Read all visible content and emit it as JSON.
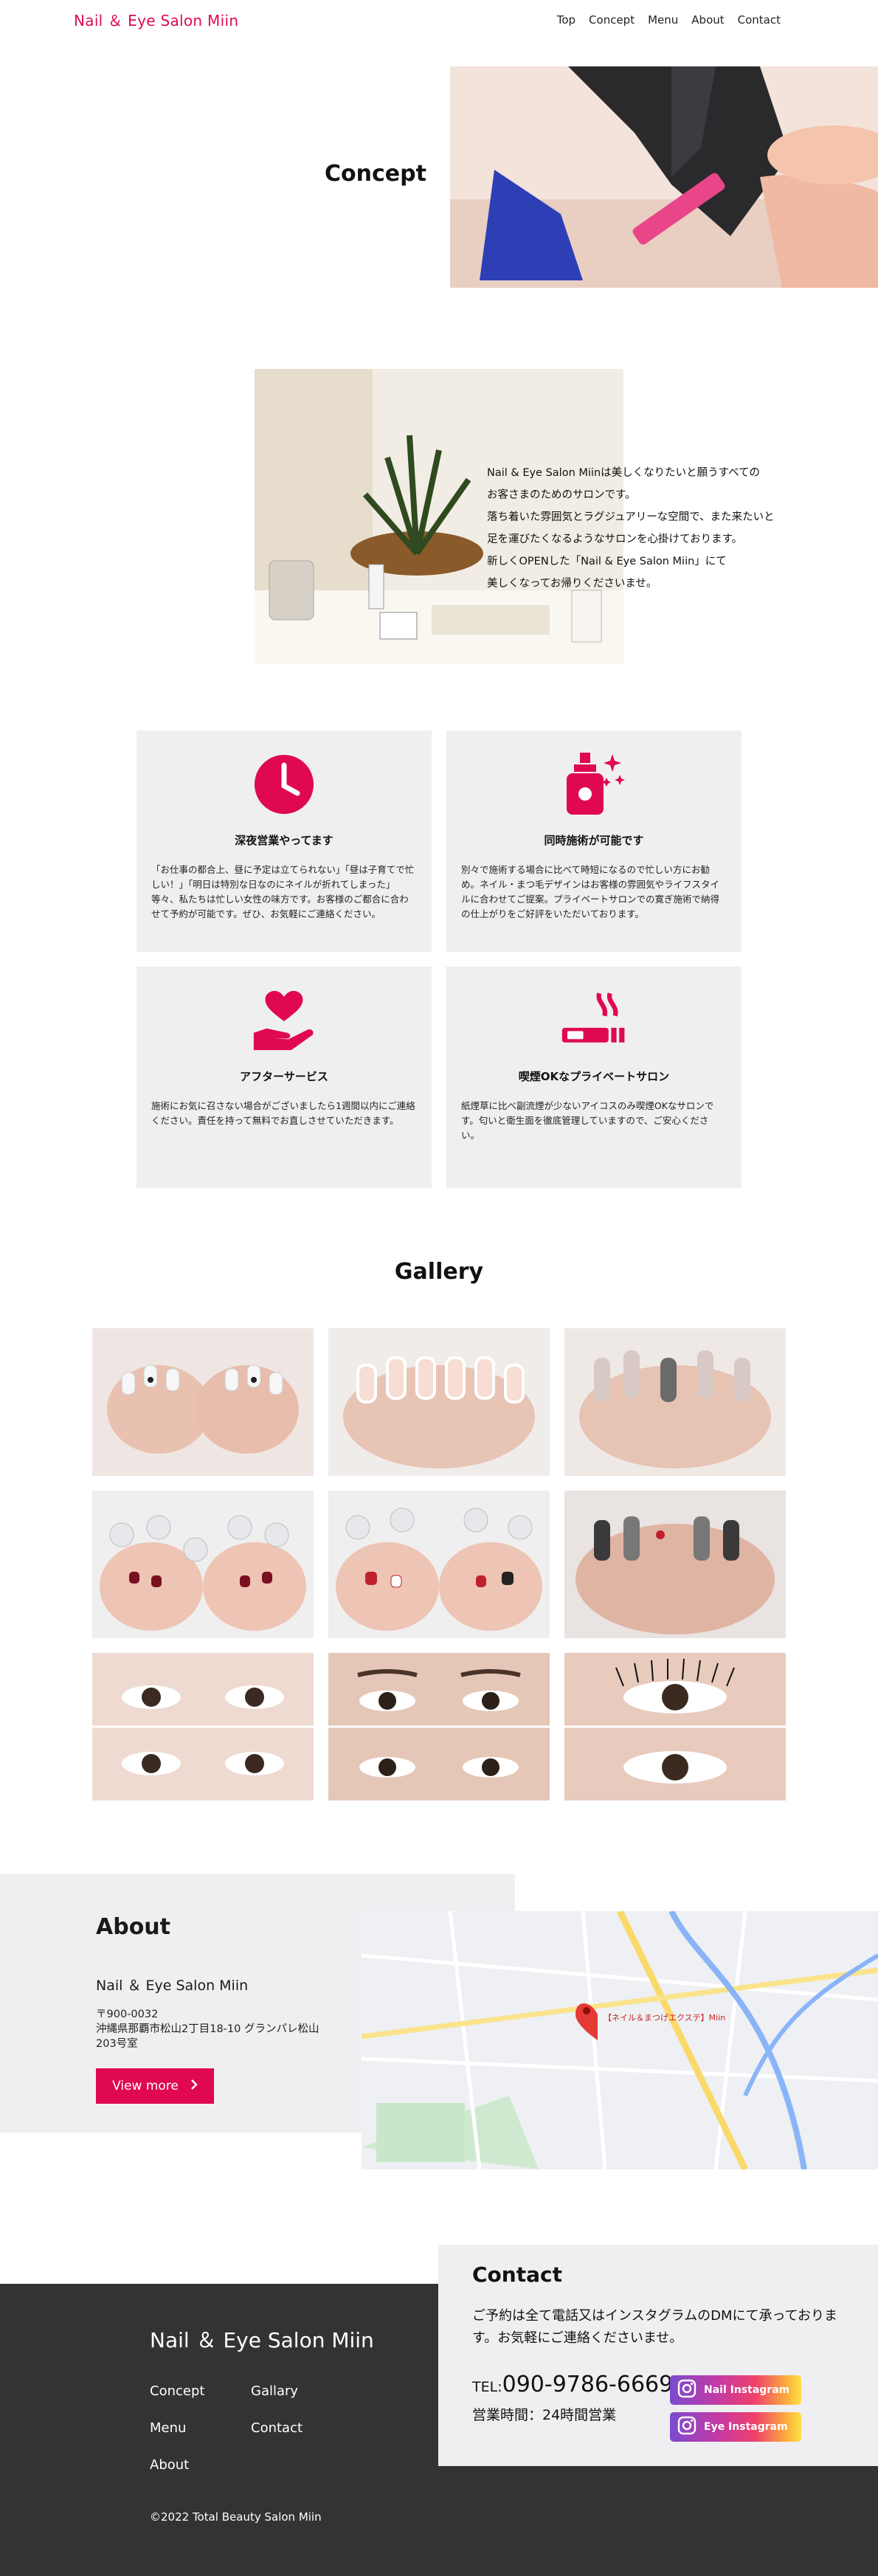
{
  "header": {
    "brand": "Nail ＆ Eye Salon Miin",
    "nav": [
      "Top",
      "Concept",
      "Menu",
      "About",
      "Contact"
    ]
  },
  "hero": {
    "title": "Concept"
  },
  "intro": {
    "lines": [
      "Nail & Eye Salon Miinは美しくなりたいと願うすべての",
      "お客さまのためのサロンです。",
      "落ち着いた雰囲気とラグジュアリーな空間で、また来たいと",
      "足を運びたくなるようなサロンを心掛けております。",
      "新しくOPENした「Nail & Eye Salon Miin」にて",
      "美しくなってお帰りくださいませ。"
    ]
  },
  "features": [
    {
      "icon": "clock-icon",
      "title": "深夜営業やってます",
      "text": "「お仕事の都合上、昼に予定は立てられない」「昼は子育てで忙しい！」「明日は特別な日なのにネイルが折れてしまった」等々、私たちは忙しい女性の味方です。お客様のご都合に合わせて予約が可能です。ぜひ、お気軽にご連絡ください。"
    },
    {
      "icon": "perfume-sparkle-icon",
      "title": "同時施術が可能です",
      "text": "別々で施術する場合に比べて時短になるので忙しい方にお勧め。ネイル・まつ毛デザインはお客様の雰囲気やライフスタイルに合わせてご提案。プライベートサロンでの寛ぎ施術で納得の仕上がりをご好評をいただいております。"
    },
    {
      "icon": "heart-hand-icon",
      "title": "アフターサービス",
      "text": "施術にお気に召さない場合がございましたら1週間以内にご連絡ください。責任を持って無料でお直しさせていただきます。"
    },
    {
      "icon": "cigarette-icon",
      "title": "喫煙OKなプライベートサロン",
      "text": "紙煙草に比べ副流煙が少ないアイコスのみ喫煙OKなサロンです。匂いと衛生面を徹底管理していますので、ご安心ください。"
    }
  ],
  "gallery": {
    "title": "Gallery"
  },
  "about": {
    "title": "About",
    "name": "Nail ＆ Eye Salon Miin",
    "postal": "〒900-0032",
    "address": "沖縄県那覇市松山2丁目18-10 グランパレ松山 203号室",
    "button": "View more",
    "map_pin": "【ネイル＆まつげエクステ】Miin"
  },
  "contact": {
    "title": "Contact",
    "text": "ご予約は全て電話又はインスタグラムのDMにて承っております。お気軽にご連絡くださいませ。",
    "tel_prefix": "TEL:",
    "tel": "090-9786-6669",
    "hours": "営業時間：24時間営業",
    "instagram_nail": "Nail Instagram",
    "instagram_eye": "Eye Instagram"
  },
  "footer": {
    "brand": "Nail ＆ Eye Salon Miin",
    "links": [
      "Concept",
      "Gallary",
      "Menu",
      "Contact",
      "About"
    ],
    "copyright": "©2022 Total Beauty Salon Miin"
  },
  "colors": {
    "accent": "#e0094f",
    "panel": "#efeff1",
    "footer": "#333333"
  }
}
